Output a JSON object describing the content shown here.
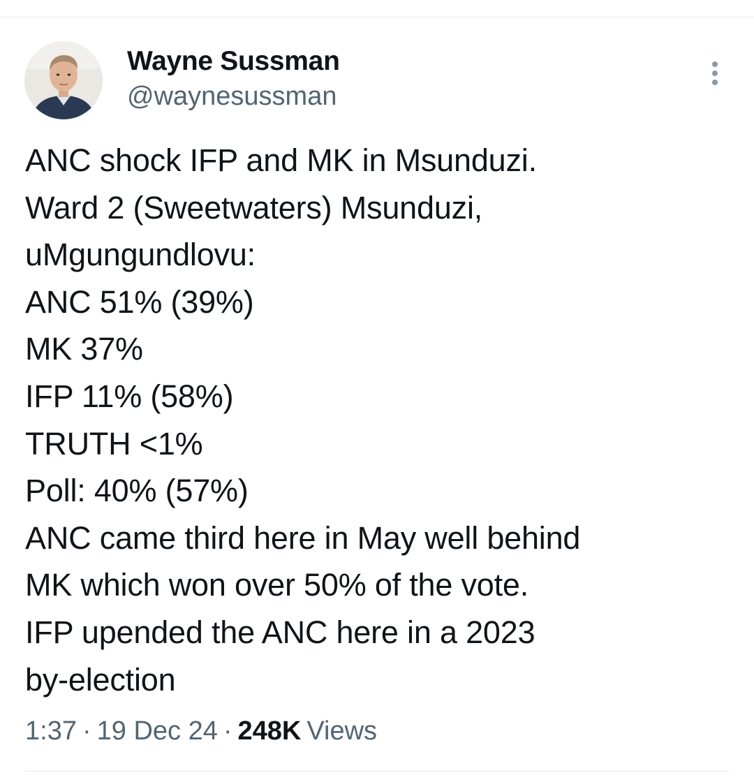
{
  "author": {
    "name": "Wayne Sussman",
    "handle": "@waynesussman"
  },
  "tweet": {
    "lines": [
      "ANC shock IFP and MK in Msunduzi.",
      "Ward 2 (Sweetwaters) Msunduzi,",
      "uMgungundlovu:",
      "ANC 51% (39%)",
      "MK 37%",
      "IFP 11% (58%)",
      "TRUTH <1%",
      "Poll: 40% (57%)",
      "ANC came third here in May well behind",
      "MK which won over 50% of the vote.",
      "IFP upended the ANC here in a 2023",
      "by-election"
    ]
  },
  "meta": {
    "time": "1:37",
    "separator": "·",
    "date": "19 Dec 24",
    "views_count": "248K",
    "views_label": "Views"
  },
  "icons": {
    "more": "more-vertical-icon",
    "avatar": "profile-photo"
  },
  "colors": {
    "text_primary": "#0f1419",
    "text_secondary": "#536471",
    "divider": "#e6e9ec"
  }
}
